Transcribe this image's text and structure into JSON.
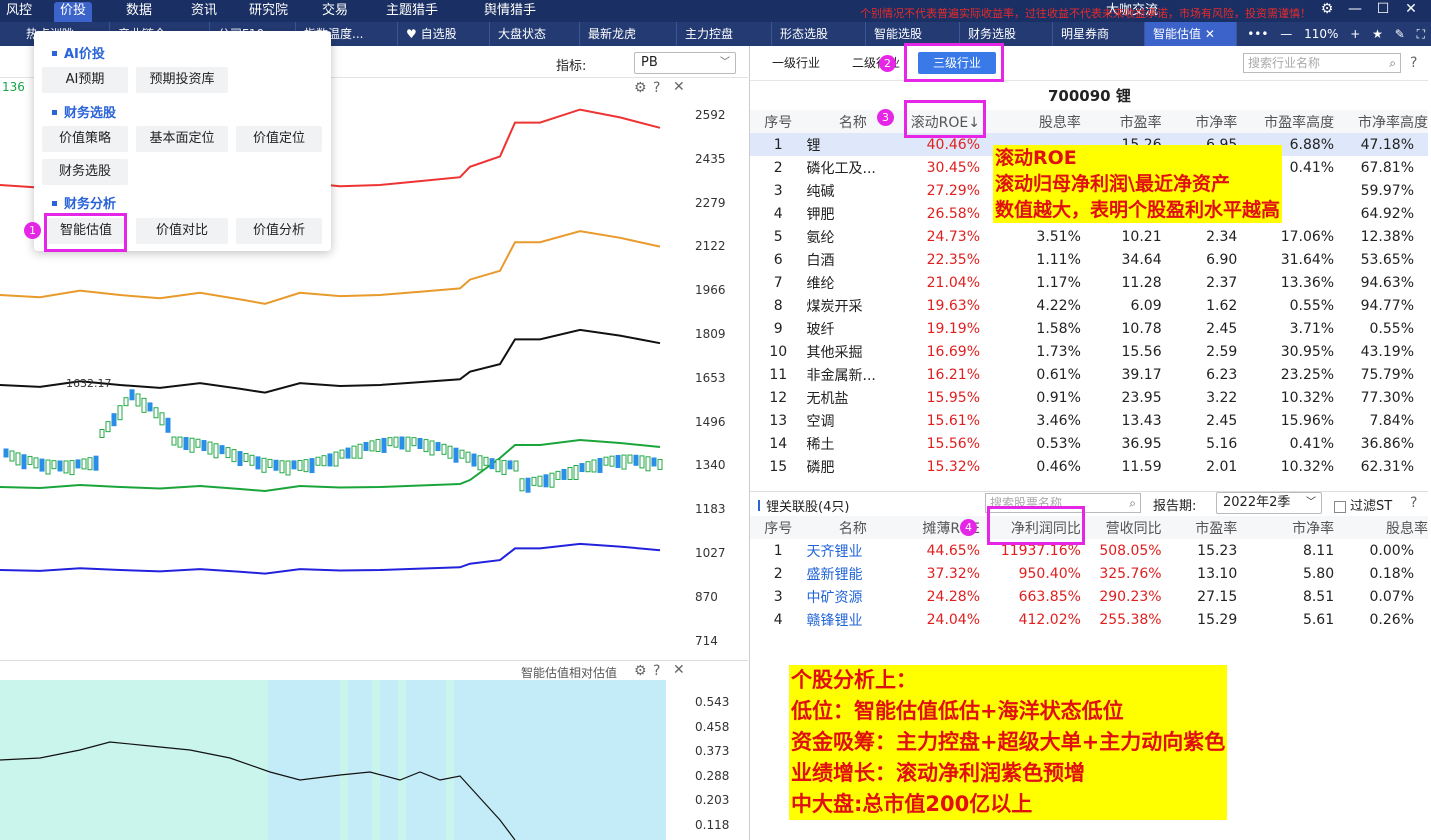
{
  "topbar": {
    "items": [
      "风控",
      "价投",
      "数据",
      "资讯",
      "研究院",
      "交易",
      "主题猎手",
      "舆情猎手"
    ],
    "active": 1,
    "community": "大咖交流",
    "warning": "个别情况不代表普遍实际收益率，过往收益不代表未来收益承诺，市场有风险，投资需谨慎！"
  },
  "tabs": {
    "items": [
      "热点训眺",
      "产业链全",
      "公司F10",
      "指数温度...",
      "♥ 自选股",
      "大盘状态",
      "最新龙虎",
      "主力控盘",
      "形态选股",
      "智能选股",
      "财务选股",
      "明星券商",
      "智能估值 ✕"
    ],
    "active": 12,
    "zoom": "110%"
  },
  "leftchart": {
    "indicator_label": "指标:",
    "indicator_value": "PB",
    "left_edge_value": "136",
    "price_label": "1632.17",
    "panel2_title": "智能估值相对估值",
    "y_ticks": [
      "2592",
      "2435",
      "2279",
      "2122",
      "1966",
      "1809",
      "1653",
      "1496",
      "1340",
      "1183",
      "1027",
      "870",
      "714"
    ],
    "y2_ticks": [
      "0.543",
      "0.458",
      "0.373",
      "0.288",
      "0.203",
      "0.118"
    ]
  },
  "menu": {
    "sections": [
      {
        "title": "AI价投",
        "items": [
          "AI预期",
          "预期投资库"
        ]
      },
      {
        "title": "财务选股",
        "items": [
          "价值策略",
          "基本面定位",
          "价值定位",
          "财务选股"
        ]
      },
      {
        "title": "财务分析",
        "items": [
          "智能估值",
          "价值对比",
          "价值分析"
        ]
      }
    ]
  },
  "badges": [
    "1",
    "2",
    "3",
    "4"
  ],
  "industry": {
    "levels": [
      "一级行业",
      "二级行业",
      "三级行业"
    ],
    "search_placeholder": "搜索行业名称",
    "title": "700090  锂",
    "headers": [
      "序号",
      "名称",
      "滚动ROE↓",
      "股息率",
      "市盈率",
      "市净率",
      "市盈率高度",
      "市净率高度"
    ],
    "rows": [
      [
        "1",
        "锂",
        "40.46%",
        "",
        "15.26",
        "6.95",
        "6.88%",
        "47.18%"
      ],
      [
        "2",
        "磷化工及...",
        "30.45%",
        "",
        "",
        "",
        "0.41%",
        "67.81%"
      ],
      [
        "3",
        "纯碱",
        "27.29%",
        "",
        "",
        "",
        "",
        "59.97%"
      ],
      [
        "4",
        "钾肥",
        "26.58%",
        "",
        "",
        "",
        "",
        "64.92%"
      ],
      [
        "5",
        "氨纶",
        "24.73%",
        "3.51%",
        "10.21",
        "2.34",
        "17.06%",
        "12.38%"
      ],
      [
        "6",
        "白酒",
        "22.35%",
        "1.11%",
        "34.64",
        "6.90",
        "31.64%",
        "53.65%"
      ],
      [
        "7",
        "维纶",
        "21.04%",
        "1.17%",
        "11.28",
        "2.37",
        "13.36%",
        "94.63%"
      ],
      [
        "8",
        "煤炭开采",
        "19.63%",
        "4.22%",
        "6.09",
        "1.62",
        "0.55%",
        "94.77%"
      ],
      [
        "9",
        "玻纤",
        "19.19%",
        "1.58%",
        "10.78",
        "2.45",
        "3.71%",
        "0.55%"
      ],
      [
        "10",
        "其他采掘",
        "16.69%",
        "1.73%",
        "15.56",
        "2.59",
        "30.95%",
        "43.19%"
      ],
      [
        "11",
        "非金属新...",
        "16.21%",
        "0.61%",
        "39.17",
        "6.23",
        "23.25%",
        "75.79%"
      ],
      [
        "12",
        "无机盐",
        "15.95%",
        "0.91%",
        "23.95",
        "3.22",
        "10.32%",
        "77.30%"
      ],
      [
        "13",
        "空调",
        "15.61%",
        "3.46%",
        "13.43",
        "2.45",
        "15.96%",
        "7.84%"
      ],
      [
        "14",
        "稀土",
        "15.56%",
        "0.53%",
        "36.95",
        "5.16",
        "0.41%",
        "36.86%"
      ],
      [
        "15",
        "磷肥",
        "15.32%",
        "0.46%",
        "11.59",
        "2.01",
        "10.32%",
        "62.31%"
      ]
    ]
  },
  "stocks": {
    "title": "锂关联股(4只)",
    "search_placeholder": "搜索股票名称",
    "report_label": "报告期:",
    "report_value": "2022年2季",
    "filter": "过滤ST",
    "headers": [
      "序号",
      "名称",
      "摊薄ROE",
      "净利润同比",
      "营收同比",
      "市盈率",
      "市净率",
      "股息率"
    ],
    "rows": [
      [
        "1",
        "天齐锂业",
        "44.65%",
        "11937.16%",
        "508.05%",
        "15.23",
        "8.11",
        "0.00%"
      ],
      [
        "2",
        "盛新锂能",
        "37.32%",
        "950.40%",
        "325.76%",
        "13.10",
        "5.80",
        "0.18%"
      ],
      [
        "3",
        "中矿资源",
        "24.28%",
        "663.85%",
        "290.23%",
        "27.15",
        "8.51",
        "0.07%"
      ],
      [
        "4",
        "赣锋锂业",
        "24.04%",
        "412.02%",
        "255.38%",
        "15.29",
        "5.61",
        "0.26%"
      ]
    ]
  },
  "annotation1": [
    "滚动ROE",
    "滚动归母净利润\\最近净资产",
    "数值越大，表明个股盈利水平越高"
  ],
  "annotation2": [
    "个股分析上：",
    "低位：智能估值低估+海洋状态低位",
    "资金吸筹：主力控盘+超级大单+主力动向紫色",
    "业绩增长：滚动净利润紫色预增",
    "中大盘:总市值200亿以上"
  ],
  "colors": {
    "nav": "#1a2f63",
    "accent": "#3a7ae8",
    "highlight": "#e626e6",
    "up": "#e02020",
    "down": "#16a34a"
  }
}
